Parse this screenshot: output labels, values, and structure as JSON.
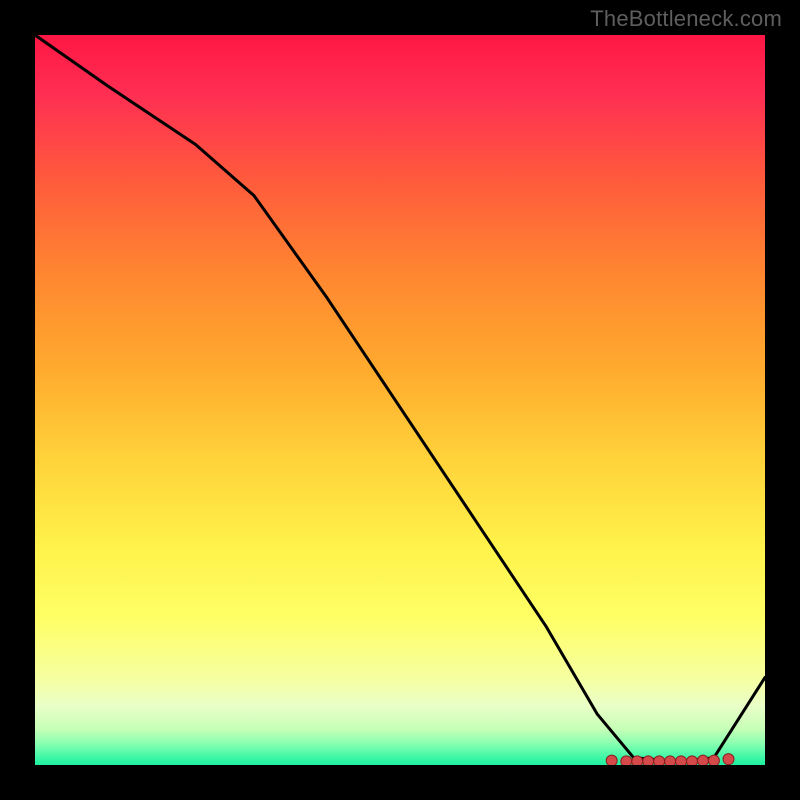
{
  "watermark": "TheBottleneck.com",
  "chart_data": {
    "type": "line",
    "title": "",
    "xlabel": "",
    "ylabel": "",
    "xlim": [
      0,
      100
    ],
    "ylim": [
      0,
      100
    ],
    "grid": false,
    "legend": false,
    "series": [
      {
        "name": "curve",
        "x": [
          0,
          10,
          22,
          30,
          40,
          50,
          60,
          70,
          77,
          82,
          88,
          93,
          100
        ],
        "values": [
          100,
          93,
          85,
          78,
          64,
          49,
          34,
          19,
          7,
          1,
          0.5,
          1,
          12
        ]
      }
    ],
    "markers": {
      "name": "highlight-points",
      "color": "#d44a4a",
      "x": [
        79,
        81,
        82.5,
        84,
        85.5,
        87,
        88.5,
        90,
        91.5,
        93,
        95
      ],
      "values": [
        0.6,
        0.5,
        0.5,
        0.5,
        0.5,
        0.5,
        0.5,
        0.5,
        0.6,
        0.6,
        0.8
      ]
    },
    "background_gradient": {
      "top": "#ff1744",
      "mid": "#ffd23a",
      "bottom": "#1eefa0"
    }
  }
}
